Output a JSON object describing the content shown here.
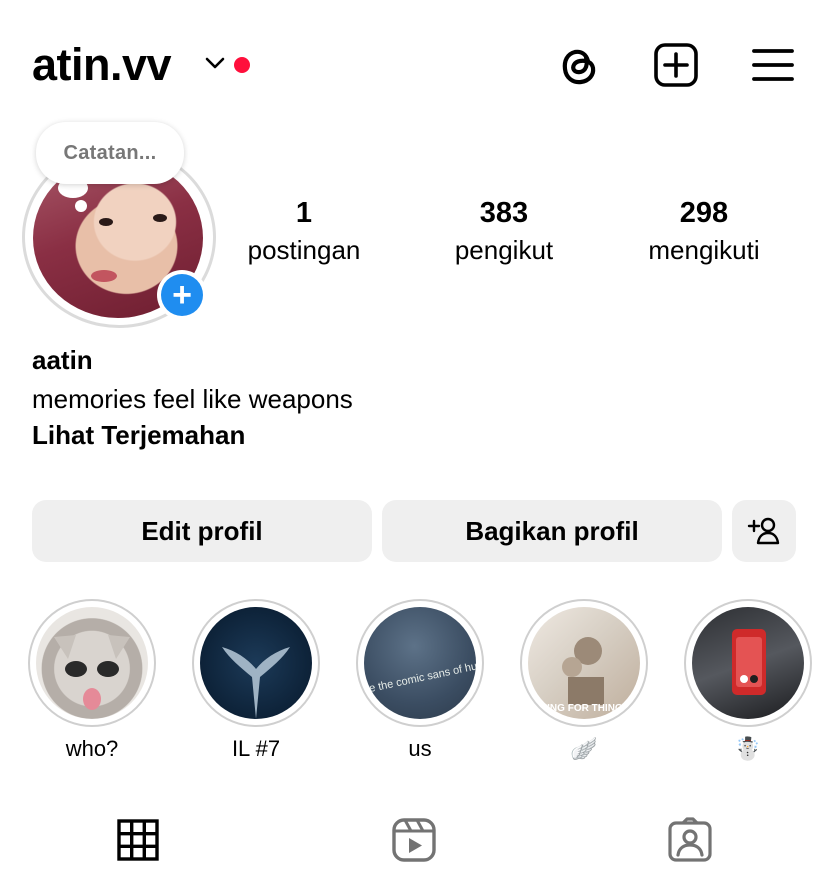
{
  "header": {
    "username": "atin.vv",
    "notification_color": "#ff0f3c",
    "icons": [
      "chevron-down-icon",
      "threads-icon",
      "create-post-icon",
      "menu-icon"
    ]
  },
  "profile": {
    "note_placeholder": "Catatan...",
    "add_story_symbol": "+",
    "accent_color": "#1f8df0",
    "stats": {
      "posts": {
        "value": "1",
        "label": "postingan"
      },
      "followers": {
        "value": "383",
        "label": "pengikut"
      },
      "following": {
        "value": "298",
        "label": "mengikuti"
      }
    },
    "full_name": "aatin",
    "bio": "memories feel like weapons",
    "translate_label": "Lihat Terjemahan"
  },
  "actions": {
    "edit_label": "Edit profil",
    "share_label": "Bagikan profil",
    "suggest_icon": "add-person-icon"
  },
  "highlights": [
    {
      "label": "who?"
    },
    {
      "label": "IL #7"
    },
    {
      "label": "us",
      "image_text": "you are the comic sans of humans"
    },
    {
      "label": "🪽",
      "image_text": "SKING FOR THING"
    },
    {
      "label": "☃️"
    }
  ],
  "tabs": [
    "grid-icon",
    "reels-icon",
    "tagged-icon"
  ]
}
